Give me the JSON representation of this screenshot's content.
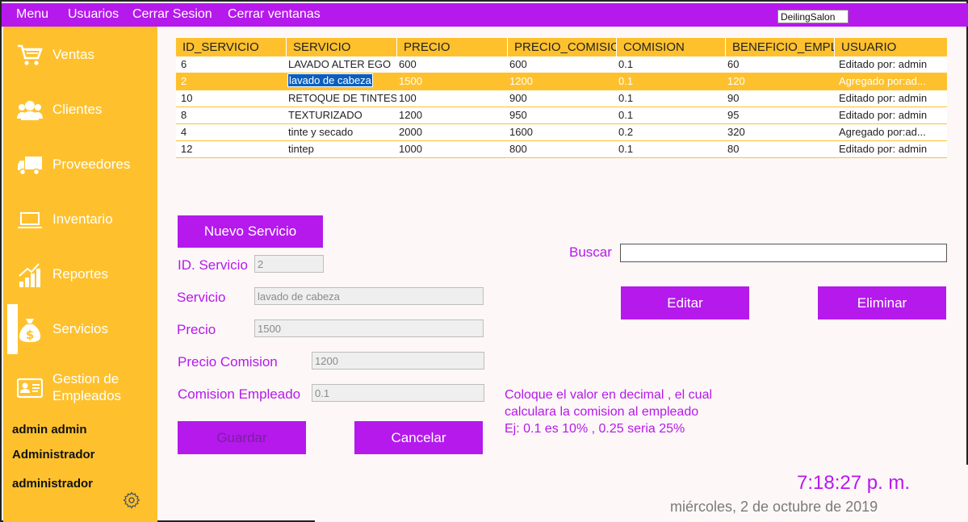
{
  "menubar": {
    "items": [
      "Menu",
      "Usuarios",
      "Cerrar Sesion",
      "Cerrar ventanas"
    ],
    "brand": "DeilingSalon"
  },
  "sidebar": {
    "items": [
      {
        "label": "Ventas",
        "icon": "cart-icon"
      },
      {
        "label": "Clientes",
        "icon": "users-icon"
      },
      {
        "label": "Proveedores",
        "icon": "truck-icon"
      },
      {
        "label": "Inventario",
        "icon": "laptop-icon"
      },
      {
        "label": "Reportes",
        "icon": "chart-icon"
      },
      {
        "label": "Servicios",
        "icon": "money-bag-icon"
      },
      {
        "label": "Gestion de Empleados",
        "icon": "id-card-icon"
      }
    ],
    "active": "Servicios",
    "user_name": "admin admin",
    "user_role": "Administrador",
    "user_login": "administrador"
  },
  "table": {
    "headers": [
      "ID_SERVICIO",
      "SERVICIO",
      "PRECIO",
      "PRECIO_COMISIO",
      "COMISION",
      "BENEFICIO_EMPLE",
      "USUARIO"
    ],
    "rows": [
      [
        "6",
        "LAVADO ALTER EGO",
        "600",
        "600",
        "0.1",
        "60",
        "Editado por: admin"
      ],
      [
        "2",
        "lavado de cabeza",
        "1500",
        "1200",
        "0.1",
        "120",
        "Agregado por:ad..."
      ],
      [
        "10",
        "RETOQUE DE TINTES",
        "100",
        "900",
        "0.1",
        "90",
        "Editado por: admin"
      ],
      [
        "8",
        "TEXTURIZADO",
        "1200",
        "950",
        "0.1",
        "95",
        "Editado por: admin"
      ],
      [
        "4",
        "tinte y secado",
        "2000",
        "1600",
        "0.2",
        "320",
        "Agregado por:ad..."
      ],
      [
        "12",
        "tintep",
        "1000",
        "800",
        "0.1",
        "80",
        "Editado por: admin"
      ]
    ],
    "selected_row": 1
  },
  "form": {
    "new_button": "Nuevo Servicio",
    "id_label": "ID. Servicio",
    "id_value": "2",
    "servicio_label": "Servicio",
    "servicio_value": "lavado de cabeza",
    "precio_label": "Precio",
    "precio_value": "1500",
    "precio_comision_label": "Precio Comision",
    "precio_comision_value": "1200",
    "comision_label": "Comision Empleado",
    "comision_value": "0.1",
    "save_button": "Guardar",
    "cancel_button": "Cancelar",
    "note_line1": "Coloque el valor en decimal ,  el cual",
    "note_line2": "calculara la comision al empleado",
    "note_line3": "Ej: 0.1  es 10% ,  0.25 seria 25%"
  },
  "search": {
    "label": "Buscar",
    "value": "",
    "edit_button": "Editar",
    "delete_button": "Eliminar"
  },
  "status": {
    "time": "7:18:27 p. m.",
    "date": "miércoles, 2 de octubre de 2019"
  },
  "colors": {
    "accent": "#b519ec",
    "sidebar": "#fec12d",
    "background": "#fdf7f8"
  }
}
